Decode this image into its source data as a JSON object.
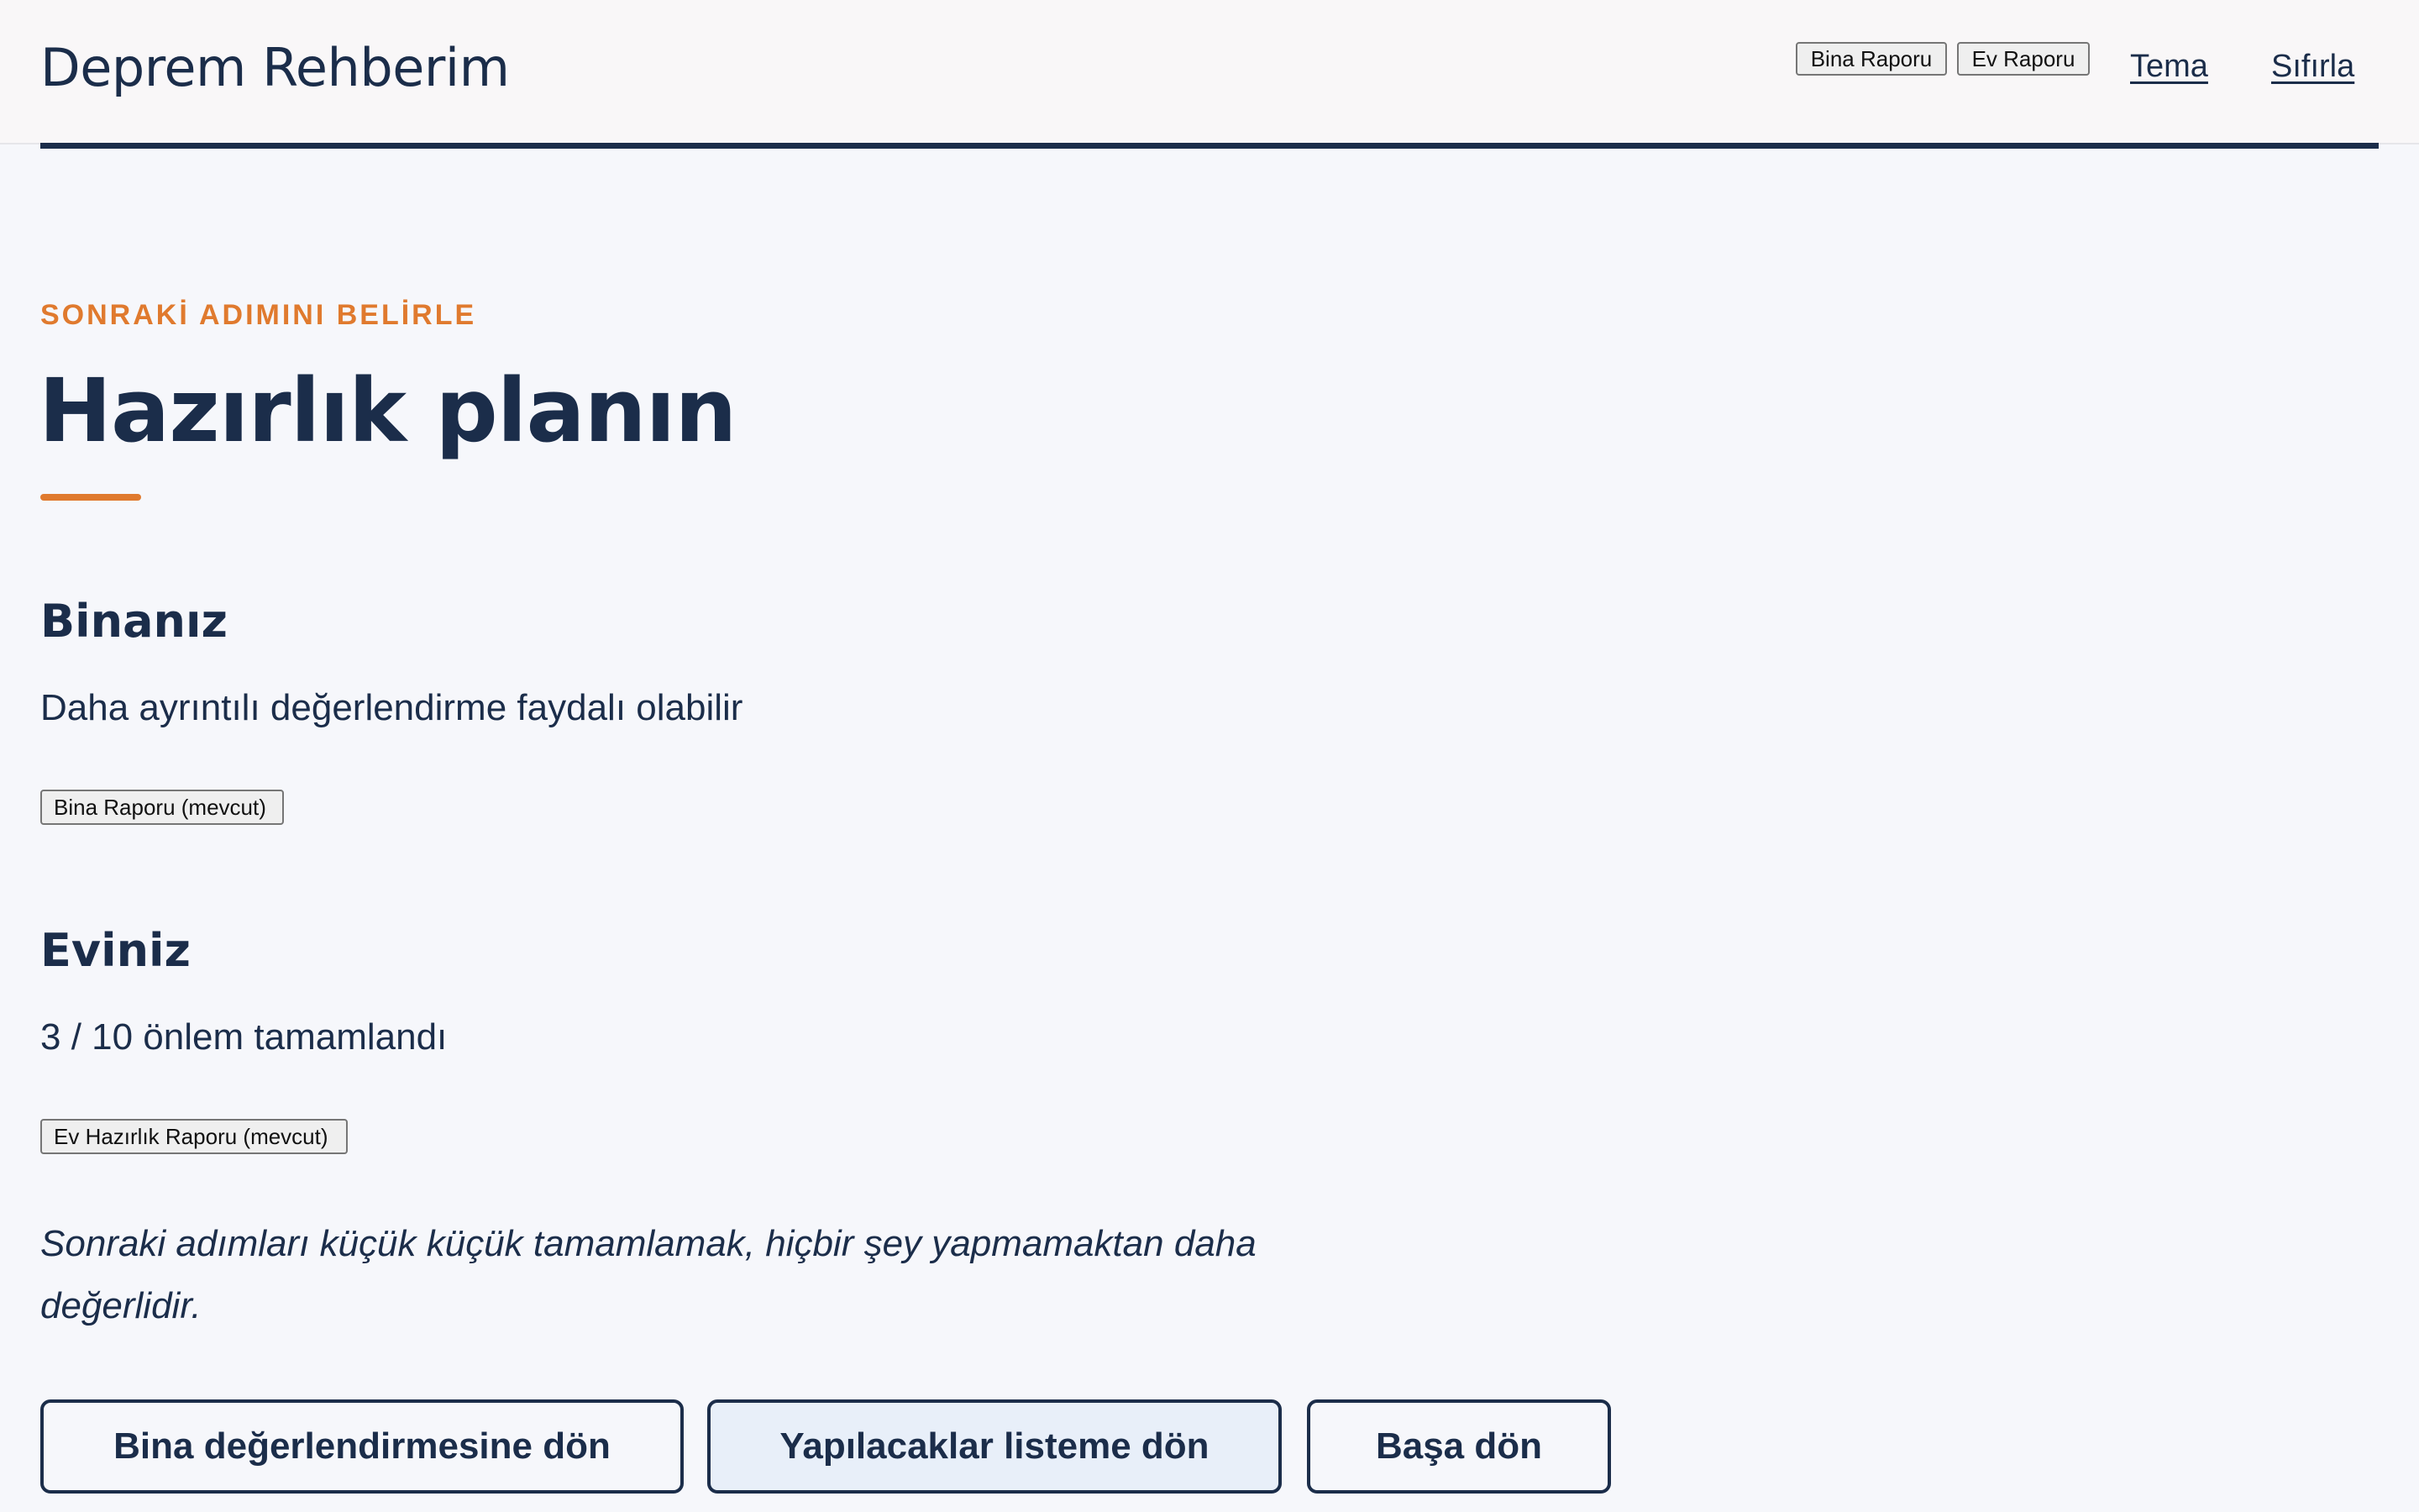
{
  "header": {
    "brand": "Deprem Rehberim",
    "buttons": {
      "bina_report": "Bina Raporu",
      "ev_report": "Ev Raporu"
    },
    "links": {
      "theme": "Tema",
      "reset": "Sıfırla"
    }
  },
  "main": {
    "eyebrow": "SONRAKİ ADIMINI BELİRLE",
    "title": "Hazırlık planın",
    "sections": {
      "bina": {
        "title": "Binanız",
        "text": "Daha ayrıntılı değerlendirme faydalı olabilir",
        "report_button": "Bina Raporu (mevcut)"
      },
      "ev": {
        "title": "Eviniz",
        "text": "3 / 10 önlem tamamlandı",
        "report_button": "Ev Hazırlık Raporu (mevcut)"
      }
    },
    "note": "Sonraki adımları küçük küçük tamamlamak, hiçbir şey yapmamaktan daha değerlidir.",
    "actions": {
      "back_to_building": "Bina değerlendirmesine dön",
      "back_to_list": "Yapılacaklar listeme dön",
      "back_to_start": "Başa dön"
    }
  },
  "colors": {
    "primary": "#1b2d4a",
    "accent": "#e07a2e",
    "background": "#f6f7fb",
    "header_background": "#f9f7f8",
    "highlight_button": "#e8eff9"
  }
}
